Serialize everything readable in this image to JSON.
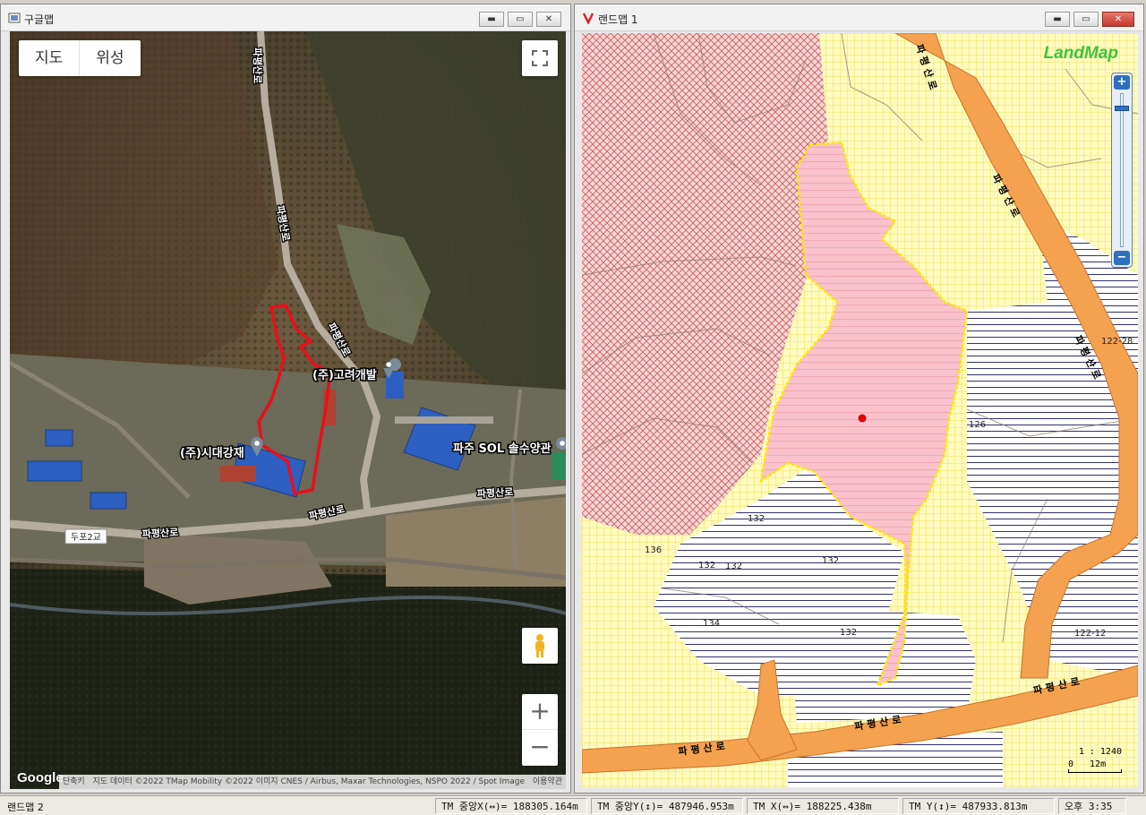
{
  "google_window": {
    "title": "구글맵",
    "map_type": {
      "map": "지도",
      "satellite": "위성"
    },
    "labels": {
      "road_pyeongsan_north": "파평산로",
      "road_pyeongsan_mid": "파평산로",
      "road_pyeongsan_curve": "파평산로",
      "road_pyeongsan_south": "파평산로",
      "road_pyeongsan_west": "파평산로",
      "road_pyeongsan_east": "파평산로",
      "company_goryeo": "(주)고려개발",
      "company_sidae": "(주)시대강재",
      "company_sol": "파주 SOL 솔수양관",
      "bridge": "두포2교"
    },
    "zoom_in": "+",
    "zoom_out": "−",
    "logo": "Google",
    "attribution_shortcut": "단축키",
    "attribution": "지도 데이터 ©2022 TMap Mobility ©2022 이미지 CNES / Airbus, Maxar Technologies, NSPO 2022 / Spot Image",
    "terms": "이용약관",
    "outline_color": "#e8101a"
  },
  "landmap_window": {
    "title": "랜드맵 1",
    "logo": "LandMap",
    "zoom_top": "+",
    "zoom_bottom": "−",
    "scale_text": "1 : 1240",
    "scale_zero": "0",
    "scale_len": "12m",
    "road_labels": {
      "north": "파평산로",
      "east_vertical": "파평산로",
      "east_lower": "파평산로",
      "south_center": "파평산로",
      "south_west": "파평산로",
      "south_east": "파평산로"
    },
    "parcel_numbers": [
      "122-28",
      "126",
      "132",
      "136",
      "132",
      "132",
      "132",
      "134",
      "132",
      "122-12"
    ],
    "colors": {
      "road": "#f4a24f",
      "pink_parcel": "#f9c2cc",
      "yellow_zone": "#fff9b0",
      "hatch_red": "#c85a5a",
      "hatch_navy": "#1a1a5c"
    }
  },
  "statusbar": {
    "app": "랜드맵 2",
    "tm_center_x": "TM 중앙X(↔)= 188305.164m",
    "tm_center_y": "TM 중앙Y(↕)= 487946.953m",
    "tm_x": "TM X(↔)= 188225.438m",
    "tm_y": "TM Y(↕)= 487933.813m",
    "clock": "오후 3:35"
  }
}
